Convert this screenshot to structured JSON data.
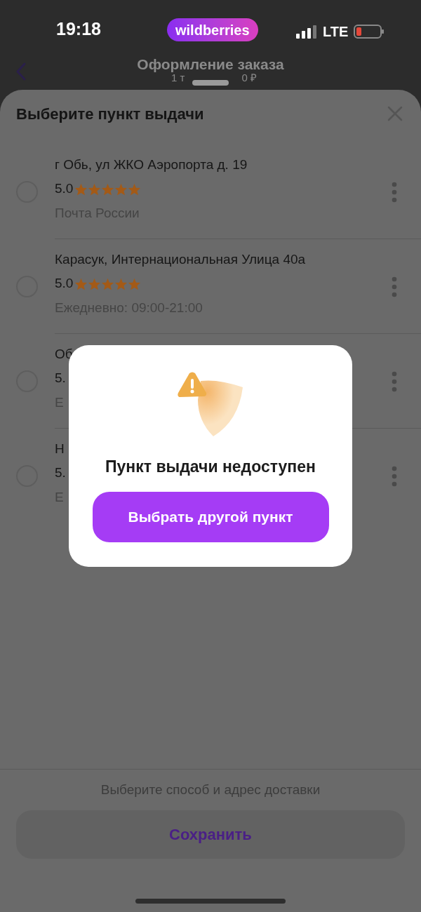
{
  "status_bar": {
    "time": "19:18",
    "app_badge": "wildberries",
    "network": "LTE"
  },
  "header": {
    "title": "Оформление заказа",
    "subtitle_parts": [
      "1 т",
      "0 ₽"
    ]
  },
  "sheet": {
    "title": "Выберите пункт выдачи",
    "items": [
      {
        "address": "г Обь, ул ЖКО Аэропорта д. 19",
        "rating": "5.0",
        "stars": 5,
        "detail": "Почта России",
        "selected": false
      },
      {
        "address": "Карасук, Интернациональная Улица 40а",
        "rating": "5.0",
        "stars": 5,
        "detail": "Ежедневно: 09:00-21:00",
        "selected": false
      },
      {
        "address": "Об",
        "rating": "5.",
        "detail": "Е",
        "selected": false
      },
      {
        "address": "Н",
        "rating": "5.",
        "detail": "Е",
        "selected": false
      }
    ],
    "hint": "Выберите способ и адрес доставки",
    "save_button": "Сохранить"
  },
  "dialog": {
    "title": "Пункт выдачи недоступен",
    "button": "Выбрать другой пункт"
  }
}
